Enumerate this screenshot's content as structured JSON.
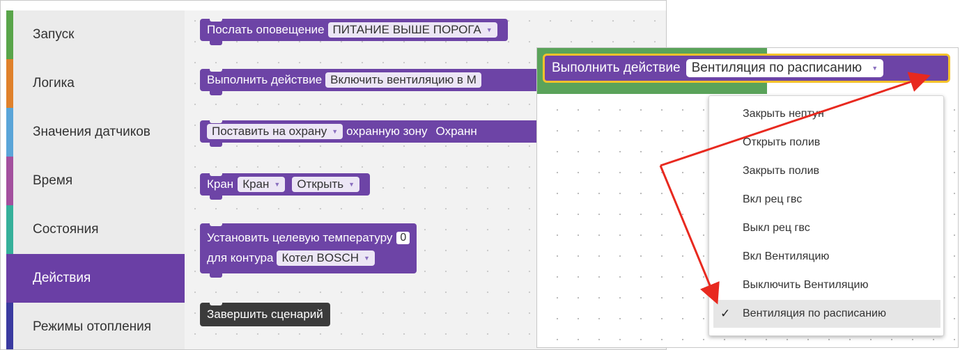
{
  "toolbox": {
    "categories": [
      {
        "label": "Запуск",
        "color": "#59a54a"
      },
      {
        "label": "Логика",
        "color": "#e0812b"
      },
      {
        "label": "Значения датчиков",
        "color": "#5aa5d8"
      },
      {
        "label": "Время",
        "color": "#a3509e"
      },
      {
        "label": "Состояния",
        "color": "#35b09a"
      },
      {
        "label": "Действия",
        "color": "#6a3fa5"
      },
      {
        "label": "Режимы отопления",
        "color": "#3a3aa0"
      }
    ],
    "selected": "Действия"
  },
  "blocks": {
    "notify": {
      "label": "Послать оповещение",
      "value": "ПИТАНИЕ ВЫШЕ ПОРОГА"
    },
    "action": {
      "label": "Выполнить действие",
      "value": "Включить вентиляцию в М"
    },
    "guard": {
      "value": "Поставить на охрану",
      "label": "охранную зону",
      "label2": "Охранн"
    },
    "valve": {
      "label": "Кран",
      "value1": "Кран",
      "value2": "Открыть"
    },
    "temp": {
      "label": "Установить целевую температуру",
      "number": "0",
      "label2": "для контура",
      "value": "Котел BOSCH"
    },
    "end": {
      "label": "Завершить сценарий"
    }
  },
  "zoom_panel": {
    "block_label": "Выполнить действие",
    "block_value": "Вентиляция по расписанию",
    "options": [
      "Закрыть нептун",
      "Открыть полив",
      "Закрыть полив",
      "Вкл рец гвс",
      "Выкл рец гвс",
      "Вкл Вентиляцию",
      "Выключить Вентиляцию",
      "Вентиляция по расписанию"
    ],
    "selected_option": "Вентиляция по расписанию",
    "check_mark": "✓"
  },
  "colors": {
    "block_purple": "#6d44a6",
    "highlight": "#f4c22b",
    "arrow_red": "#e8291f"
  }
}
